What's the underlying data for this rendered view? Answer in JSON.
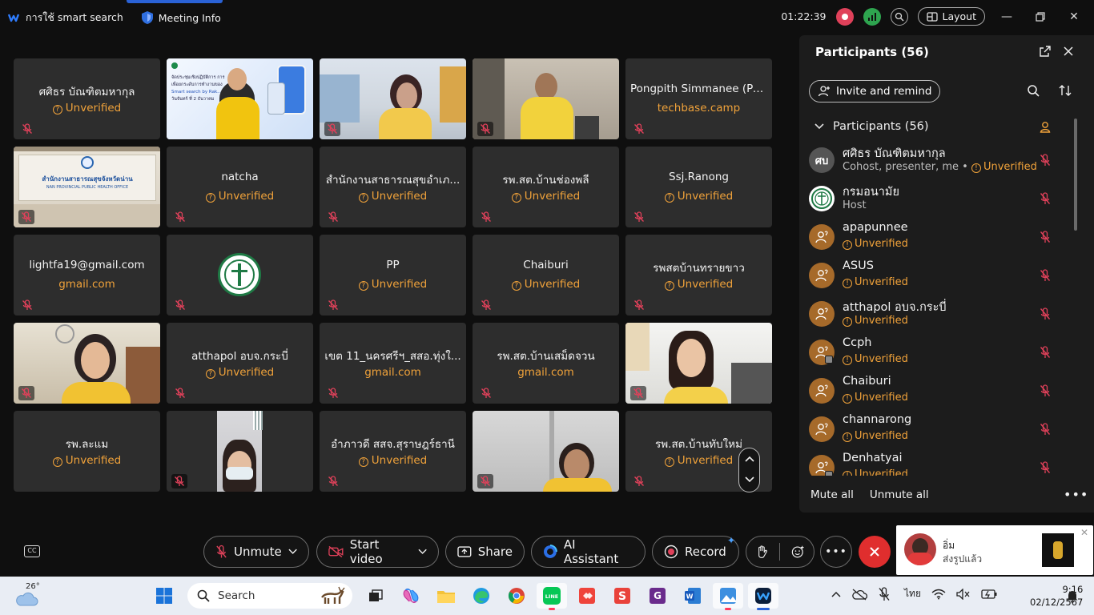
{
  "topbar": {
    "smart_search": "การใช้ smart search",
    "meeting_info": "Meeting Info",
    "timer": "01:22:39",
    "layout": "Layout"
  },
  "grid": {
    "tiles": [
      {
        "name": "ศศิธร บัณฑิตมหากุล",
        "sub": "Unverified"
      },
      {
        "name": "Pongpith Simmanee (Pod)",
        "sub": "techbase.camp"
      },
      {
        "name": "natcha",
        "sub": "Unverified"
      },
      {
        "name": "สำนักงานสาธารณสุขอำเภ...",
        "sub": "Unverified"
      },
      {
        "name": "รพ.สต.บ้านช่องพลี",
        "sub": "Unverified"
      },
      {
        "name": "Ssj.Ranong",
        "sub": "Unverified"
      },
      {
        "name": "lightfa19@gmail.com",
        "sub": "gmail.com"
      },
      {
        "name": "PP",
        "sub": "Unverified"
      },
      {
        "name": "Chaiburi",
        "sub": "Unverified"
      },
      {
        "name": "รพสตบ้านทรายขาว",
        "sub": "Unverified"
      },
      {
        "name": "atthapol อบจ.กระบี่",
        "sub": "Unverified"
      },
      {
        "name": "เขต 11_นครศรีฯ_สสอ.ทุ่งใ...",
        "sub": "gmail.com"
      },
      {
        "name": "รพ.สต.บ้านเสม็ดจวน",
        "sub": "gmail.com"
      },
      {
        "name": "รพ.ละแม",
        "sub": "Unverified"
      },
      {
        "name": "อำภาวดี สสจ.สุราษฎร์ธานี",
        "sub": "Unverified"
      },
      {
        "name": "รพ.สต.บ้านทับใหม่",
        "sub": "Unverified"
      }
    ],
    "office_sign_th": "สำนักงานสาธารณสุขจังหวัดน่าน",
    "office_sign_en": "NAN PROVINCIAL PUBLIC HEALTH OFFICE",
    "slide_lines": [
      "จัดประชุมเชิงปฏิบัติการ การ",
      "เพื่อยกระดับการทำงานของ",
      "Smart search by Rak...service 3",
      "วันจันทร์ ที่ 2 ธันวาคม"
    ]
  },
  "panel": {
    "title": "Participants (56)",
    "invite": "Invite and remind",
    "list_header": "Participants (56)",
    "participants": [
      {
        "name": "ศศิธร บัณฑิตมหากุล",
        "role": "Cohost, presenter, me",
        "unverified": "Unverified",
        "initials": "ศบ"
      },
      {
        "name": "กรมอนามัย",
        "role": "Host",
        "unverified": "",
        "initials": ""
      },
      {
        "name": "apapunnee",
        "role": "",
        "unverified": "Unverified",
        "initials": ""
      },
      {
        "name": "ASUS",
        "role": "",
        "unverified": "Unverified",
        "initials": ""
      },
      {
        "name": "atthapol อบจ.กระบี่",
        "role": "",
        "unverified": "Unverified",
        "initials": ""
      },
      {
        "name": "Ccph",
        "role": "",
        "unverified": "Unverified",
        "initials": ""
      },
      {
        "name": "Chaiburi",
        "role": "",
        "unverified": "Unverified",
        "initials": ""
      },
      {
        "name": "channarong",
        "role": "",
        "unverified": "Unverified",
        "initials": ""
      },
      {
        "name": "Denhatyai",
        "role": "",
        "unverified": "Unverified",
        "initials": ""
      }
    ],
    "mute_all": "Mute all",
    "unmute_all": "Unmute all"
  },
  "controls": {
    "unmute": "Unmute",
    "start_video": "Start video",
    "share": "Share",
    "ai_assistant": "AI Assistant",
    "record": "Record"
  },
  "toast": {
    "sender": "อิ่ม",
    "message": "ส่งรูปแล้ว"
  },
  "taskbar": {
    "temperature": "26°",
    "search": "Search",
    "language": "ไทย",
    "time": "9:16",
    "date": "02/12/2567"
  },
  "colors": {
    "accent": "#2a62d6",
    "unverified": "#f0a23a",
    "mic_off": "#e0415a",
    "end_call": "#e02e2e"
  }
}
